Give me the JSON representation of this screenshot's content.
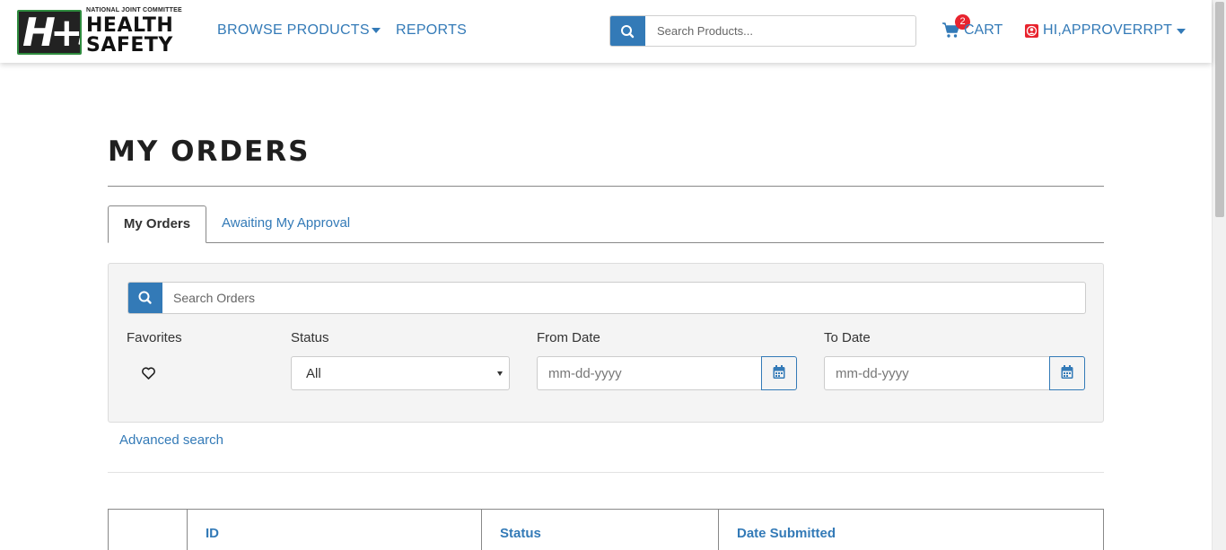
{
  "header": {
    "logo": {
      "tagline": "NATIONAL JOINT COMMITTEE",
      "line1": "HEALTH",
      "line2": "SAFETY",
      "mark": "H+S"
    },
    "nav": {
      "browse": "BROWSE PRODUCTS",
      "reports": "REPORTS"
    },
    "search": {
      "placeholder": "Search Products..."
    },
    "cart": {
      "label": "CART",
      "count": "2"
    },
    "user": {
      "label": "HI,APPROVERRPT"
    }
  },
  "page": {
    "title": "MY ORDERS",
    "tabs": [
      {
        "label": "My Orders",
        "active": true
      },
      {
        "label": "Awaiting My Approval",
        "active": false
      }
    ],
    "filters": {
      "search_placeholder": "Search Orders",
      "favorites_label": "Favorites",
      "status_label": "Status",
      "status_value": "All",
      "from_label": "From Date",
      "from_placeholder": "mm-dd-yyyy",
      "to_label": "To Date",
      "to_placeholder": "mm-dd-yyyy"
    },
    "advanced_search": "Advanced search",
    "table": {
      "columns": [
        "",
        "ID",
        "Status",
        "Date Submitted"
      ]
    }
  },
  "colors": {
    "accent": "#337ab7",
    "badge": "#e8232e",
    "brand_green": "#2e8b3e"
  },
  "icons": [
    "search-icon",
    "cart-icon",
    "user-icon",
    "heart-icon",
    "calendar-icon",
    "chevron-down-icon"
  ]
}
